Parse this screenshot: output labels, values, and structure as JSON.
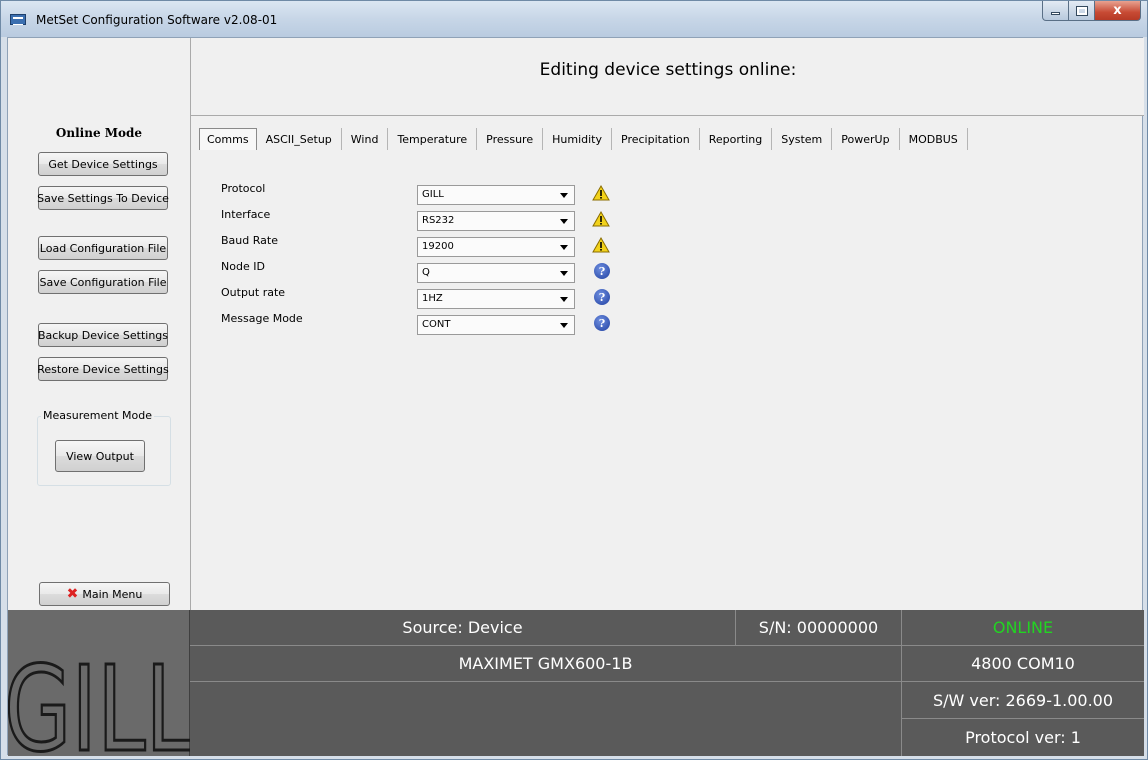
{
  "window": {
    "title": "MetSet Configuration Software v2.08-01",
    "close_glyph": "x"
  },
  "sidebar": {
    "mode_title": "Online Mode",
    "buttons": [
      "Get Device Settings",
      "Save Settings To Device",
      "Load Configuration File",
      "Save Configuration File",
      "Backup Device Settings",
      "Restore Device Settings"
    ],
    "measurement_group_label": "Measurement Mode",
    "view_output": "View Output",
    "main_menu": "Main Menu"
  },
  "header": {
    "title": "Editing device settings online:"
  },
  "tabs": [
    "Comms",
    "ASCII_Setup",
    "Wind",
    "Temperature",
    "Pressure",
    "Humidity",
    "Precipitation",
    "Reporting",
    "System",
    "PowerUp",
    "MODBUS"
  ],
  "active_tab": "Comms",
  "form": {
    "rows": [
      {
        "label": "Protocol",
        "value": "GILL",
        "icon": "warning-icon"
      },
      {
        "label": "Interface",
        "value": "RS232",
        "icon": "warning-icon"
      },
      {
        "label": "Baud Rate",
        "value": "19200",
        "icon": "warning-icon"
      },
      {
        "label": "Node ID",
        "value": "Q",
        "icon": "help-icon"
      },
      {
        "label": "Output rate",
        "value": "1HZ",
        "icon": "help-icon"
      },
      {
        "label": "Message Mode",
        "value": "CONT",
        "icon": "help-icon"
      }
    ],
    "help_glyph": "?"
  },
  "status": {
    "logo_text": "GILL",
    "source": "Source: Device",
    "serial": "S/N: 00000000",
    "connection": "ONLINE",
    "device_model": "MAXIMET GMX600-1B",
    "port": "4800 COM10",
    "sw_version": "S/W ver: 2669-1.00.00",
    "protocol_version": "Protocol ver: 1"
  },
  "colors": {
    "online": "#22d422",
    "status_bg": "#5a5a5a",
    "warning": "#f2d21b",
    "help": "#1f3fa0"
  }
}
